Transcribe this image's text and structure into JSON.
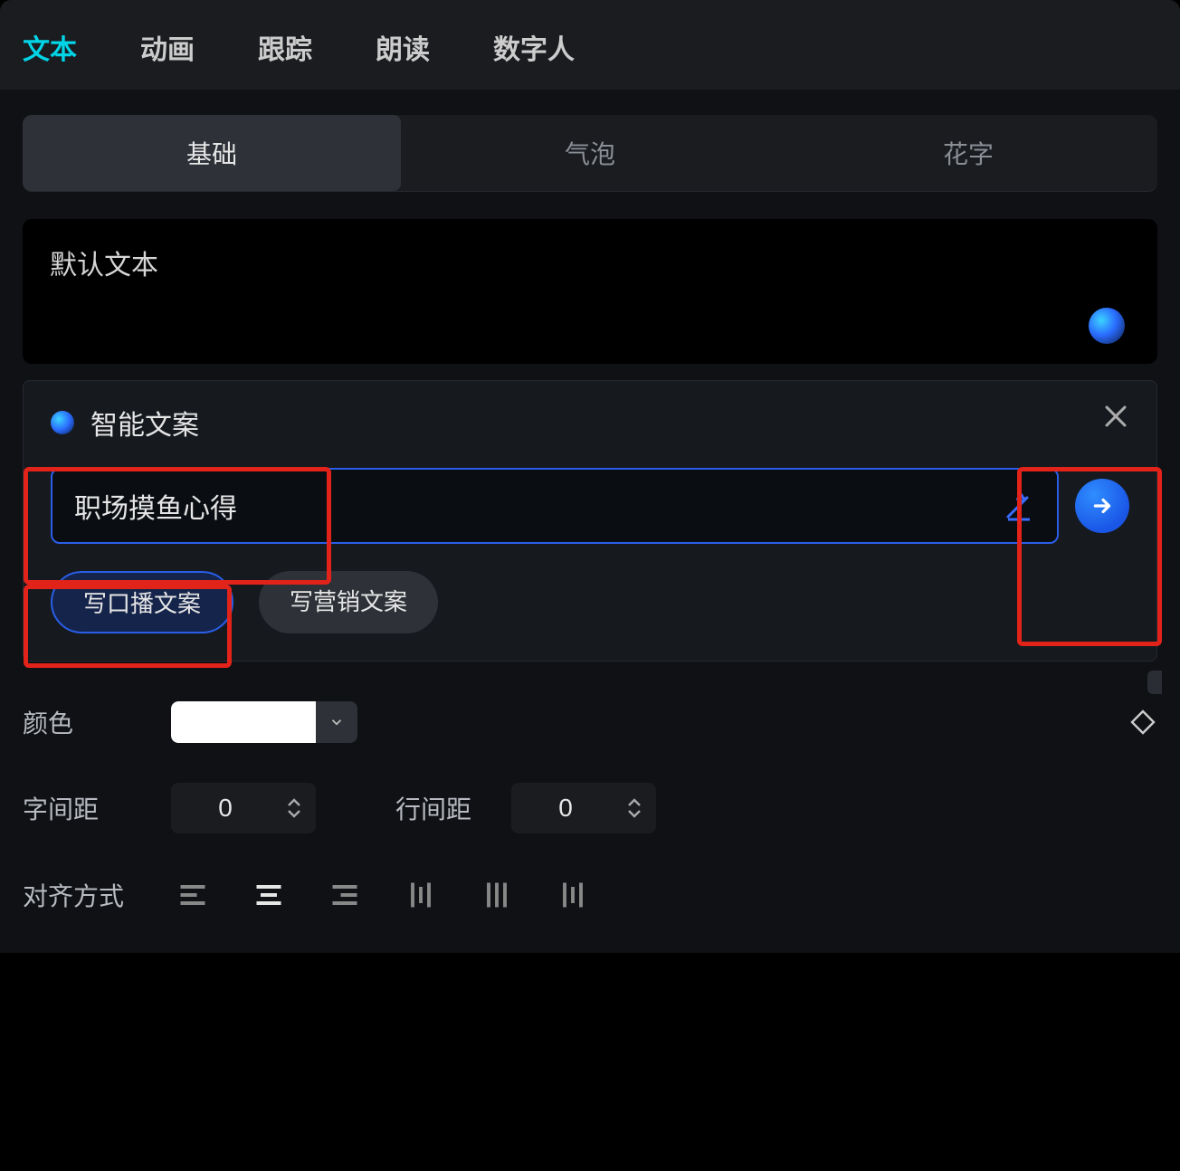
{
  "top_tabs": {
    "text": "文本",
    "animation": "动画",
    "track": "跟踪",
    "read": "朗读",
    "digital": "数字人"
  },
  "sub_tabs": {
    "basic": "基础",
    "bubble": "气泡",
    "fancy": "花字"
  },
  "textbox": {
    "value": "默认文本"
  },
  "smart": {
    "title": "智能文案",
    "input_value": "职场摸鱼心得",
    "pill_broadcast": "写口播文案",
    "pill_marketing": "写营销文案"
  },
  "labels": {
    "color": "颜色",
    "letter_spacing": "字间距",
    "line_spacing": "行间距",
    "alignment": "对齐方式"
  },
  "values": {
    "letter_spacing": "0",
    "line_spacing": "0",
    "color_hex": "#ffffff"
  }
}
